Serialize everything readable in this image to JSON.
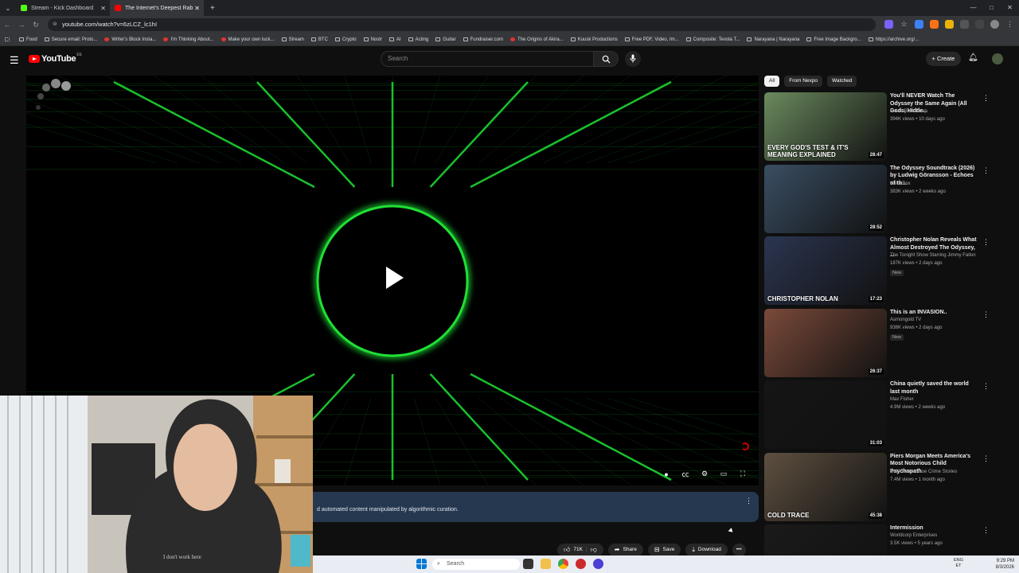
{
  "browser": {
    "tabs": [
      {
        "title": "Stream - Kick Dashboard",
        "favicon_color": "#53fc18"
      },
      {
        "title": "The Internet's Deepest Rab",
        "favicon_color": "#ff0000"
      }
    ],
    "url": "youtube.com/watch?v=6zLCZ_lc1hI",
    "bookmarks": [
      {
        "label": "Food",
        "icon": "folder"
      },
      {
        "label": "Secure email: Proto...",
        "icon": "proton"
      },
      {
        "label": "Writer's Block Insta...",
        "icon": "youtube"
      },
      {
        "label": "I'm Thinking About...",
        "icon": "youtube"
      },
      {
        "label": "Make your own luck...",
        "icon": "youtube"
      },
      {
        "label": "Stream",
        "icon": "folder"
      },
      {
        "label": "BTC",
        "icon": "folder"
      },
      {
        "label": "Crypto",
        "icon": "folder"
      },
      {
        "label": "Nostr",
        "icon": "folder"
      },
      {
        "label": "AI",
        "icon": "folder"
      },
      {
        "label": "Acting",
        "icon": "folder"
      },
      {
        "label": "Guitar",
        "icon": "folder"
      },
      {
        "label": "Fundraiser.com",
        "icon": "site"
      },
      {
        "label": "The Origins of Akira...",
        "icon": "youtube"
      },
      {
        "label": "Kuusk Productions",
        "icon": "folder"
      },
      {
        "label": "Free PDF, Video, Im...",
        "icon": "site"
      },
      {
        "label": "Composite: Tevola T...",
        "icon": "site"
      },
      {
        "label": "Narayana | Narayana",
        "icon": "site"
      },
      {
        "label": "Free Image Backgro...",
        "icon": "site"
      },
      {
        "label": "https://archive.org/...",
        "icon": "site"
      }
    ]
  },
  "youtube": {
    "logo_text": "YouTube",
    "country_code": "EE",
    "search_placeholder": "Search",
    "create_label": "Create"
  },
  "player": {
    "banner_text": "d automated content manipulated by algorithmic curation."
  },
  "actions": {
    "likes": "71K",
    "share": "Share",
    "save": "Save",
    "download": "Download"
  },
  "sidebar": {
    "chips": [
      "All",
      "From Nexpo",
      "Watched"
    ],
    "recommendations": [
      {
        "title": "You'll NEVER Watch The Odyssey the Same Again (All Gods, Hidde...",
        "channel": "Movie Balls Deep",
        "meta": "394K views • 10 days ago",
        "duration": "28:47",
        "badge": "",
        "thumb_text": "EVERY GOD'S TEST & IT'S MEANING EXPLAINED",
        "thumb_color": "#6b8a5e"
      },
      {
        "title": "The Odyssey Soundtrack (2026) by Ludwig Göransson - Echoes of th...",
        "channel": "Kaka Box",
        "meta": "383K views • 2 weeks ago",
        "duration": "28:52",
        "badge": "",
        "thumb_text": "",
        "thumb_color": "#3a4e63"
      },
      {
        "title": "Christopher Nolan Reveals What Almost Destroyed The Odyssey, ...",
        "channel": "The Tonight Show Starring Jimmy Fallon",
        "meta": "187K views • 2 days ago",
        "duration": "17:23",
        "badge": "New",
        "thumb_text": "CHRISTOPHER NOLAN",
        "thumb_color": "#2b3550"
      },
      {
        "title": "This is an INVASION..",
        "channel": "Asmongold TV",
        "meta": "936K views • 2 days ago",
        "duration": "26:37",
        "badge": "New",
        "thumb_text": "",
        "thumb_color": "#7a4a3a"
      },
      {
        "title": "China quietly saved the world last month",
        "channel": "Max Fisher",
        "meta": "4.9M views • 2 weeks ago",
        "duration": "31:03",
        "badge": "",
        "thumb_text": "",
        "thumb_color": "#151515"
      },
      {
        "title": "Piers Morgan Meets America's Most Notorious Child Psychopath",
        "channel": "Cold Trace - True Crime Stories",
        "meta": "7.4M views • 1 month ago",
        "duration": "45:38",
        "badge": "",
        "thumb_text": "COLD TRACE",
        "thumb_color": "#5e5040"
      },
      {
        "title": "Intermission",
        "channel": "Worldcorp Enterprises",
        "meta": "3.5K views • 5 years ago",
        "duration": "",
        "badge": "",
        "thumb_text": "",
        "thumb_color": "#1a1a1a"
      }
    ]
  },
  "taskbar": {
    "search_placeholder": "Search",
    "lang_line1": "ENG",
    "lang_line2": "ET",
    "time": "9:29 PM",
    "date": "8/3/2026"
  },
  "webcam": {
    "shirt_text": "I don't work here"
  },
  "colors": {
    "accent_green": "#1fe035",
    "yt_red": "#ff0000",
    "banner_bg": "#263850"
  }
}
